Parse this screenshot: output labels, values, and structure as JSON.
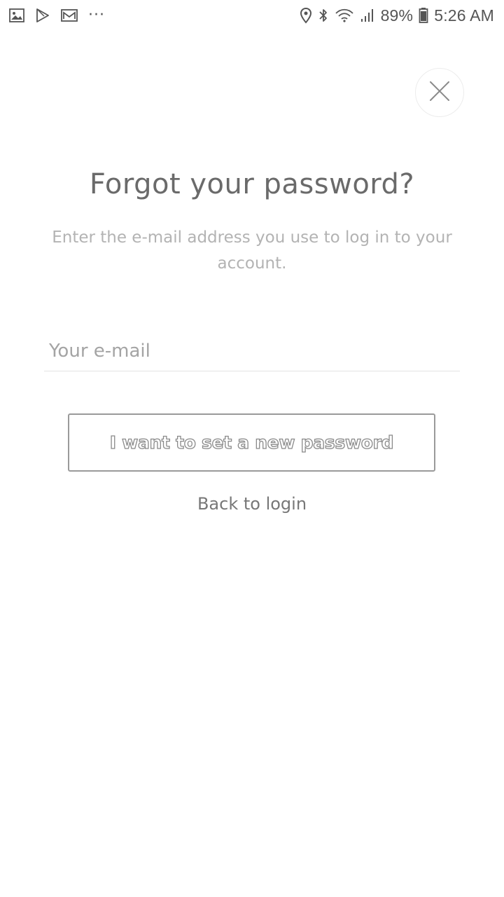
{
  "status_bar": {
    "icons_left": [
      "gallery-icon",
      "play-store-icon",
      "gmail-icon"
    ],
    "more_indicator": "···",
    "icons_right": [
      "location-icon",
      "bluetooth-icon",
      "wifi-icon",
      "signal-icon",
      "battery-icon"
    ],
    "battery": "89%",
    "time": "5:26 AM"
  },
  "close_button": {
    "icon": "close-icon"
  },
  "title": "Forgot your password?",
  "subtitle": "Enter the e-mail address you use to log in to your account.",
  "email_input": {
    "placeholder": "Your e-mail",
    "value": ""
  },
  "submit_button": {
    "label": "I want to set a new password"
  },
  "back_link": {
    "label": "Back to login"
  },
  "colors": {
    "background": "#ffffff",
    "title": "#6a6a6a",
    "subtitle": "#b3b3b3",
    "border": "#9a9a9a"
  }
}
